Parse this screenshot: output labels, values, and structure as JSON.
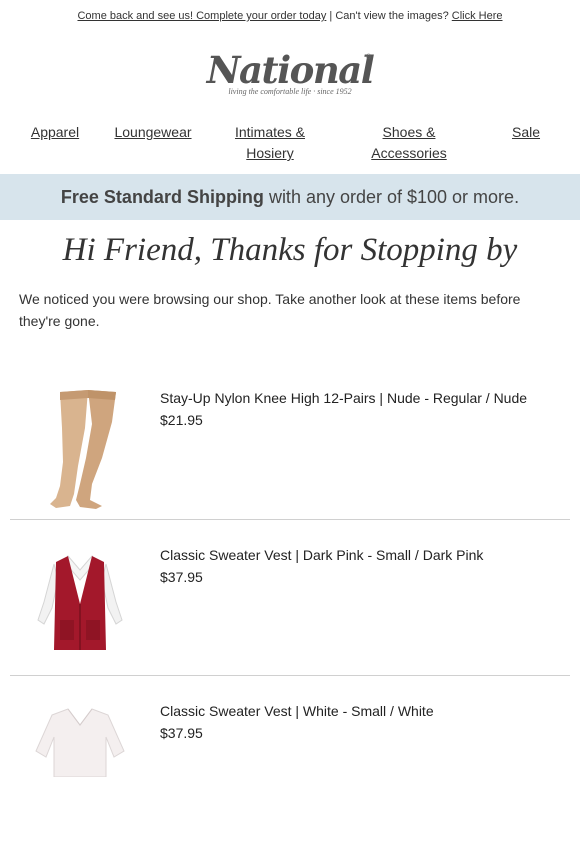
{
  "preheader": {
    "link1": "Come back and see us! Complete your order today",
    "separator": "| Can't view the images?",
    "link2": "Click Here"
  },
  "logo": {
    "wordmark": "National",
    "tagline": "living the comfortable life  ·  since 1952",
    "registered": "®"
  },
  "nav": {
    "items": [
      {
        "label": "Apparel"
      },
      {
        "label": "Loungewear"
      },
      {
        "label": "Intimates & Hosiery"
      },
      {
        "label": "Shoes & Accessories"
      },
      {
        "label": "Sale"
      }
    ]
  },
  "banner": {
    "bold": "Free Standard Shipping",
    "rest": " with any order of $100 or more."
  },
  "headline": "Hi Friend, Thanks for Stopping by",
  "intro": "We noticed you were browsing our shop. Take another look at these items before they're gone.",
  "products": [
    {
      "name": "Stay-Up Nylon Knee High 12-Pairs | Nude - Regular / Nude",
      "price": "$21.95",
      "image": "nude-knee-high-stockings"
    },
    {
      "name": "Classic Sweater Vest | Dark Pink - Small / Dark Pink",
      "price": "$37.95",
      "image": "dark-pink-sweater-vest"
    },
    {
      "name": "Classic Sweater Vest | White - Small / White",
      "price": "$37.95",
      "image": "white-sweater-vest"
    }
  ],
  "colors": {
    "banner_bg": "#d7e4ec",
    "vest_pink": "#a3182b",
    "stocking": "#d9b48f"
  }
}
